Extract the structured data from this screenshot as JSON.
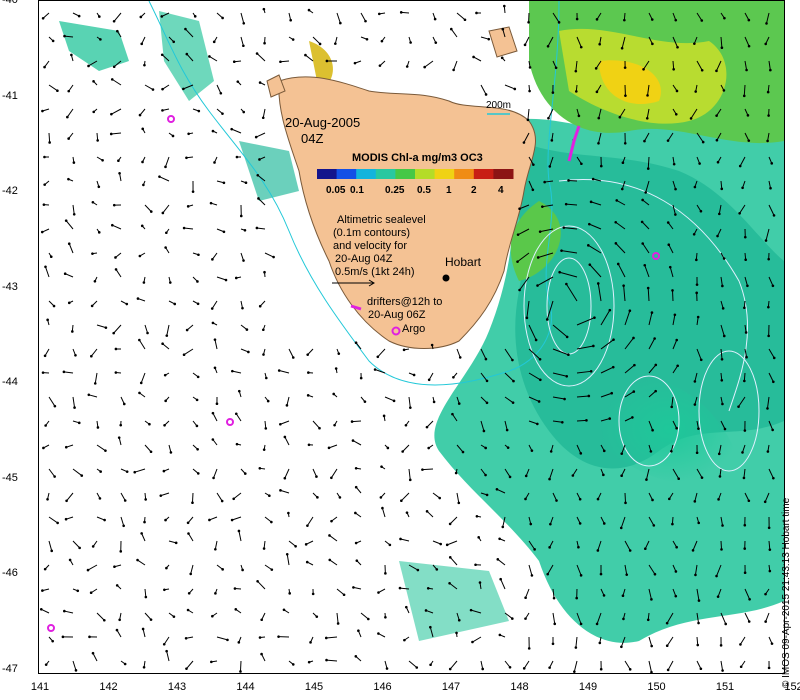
{
  "map": {
    "date_label": "20-Aug-2005",
    "time_label": "04Z",
    "scale_label": "200m",
    "city_label": "Hobart",
    "argo_label": "Argo",
    "colorbar_title": "MODIS Chl-a mg/m3 OC3",
    "colorbar_ticks": [
      "0.05",
      "0.1",
      "0.25",
      "0.5",
      "1",
      "2",
      "4"
    ],
    "legend_text": {
      "line1": "Altimetric sealevel",
      "line2": "(0.1m contours)",
      "line3": "and velocity for",
      "line4": "20-Aug 04Z",
      "line5": "0.5m/s (1kt 24h)"
    },
    "drifters_text": {
      "line1": "drifters@12h to",
      "line2": "20-Aug 06Z"
    },
    "lat_ticks": [
      "-40",
      "-41",
      "-42",
      "-43",
      "-44",
      "-45",
      "-46",
      "-47"
    ],
    "lon_ticks": [
      "141",
      "142",
      "143",
      "144",
      "145",
      "146",
      "147",
      "148",
      "149",
      "150",
      "151",
      "152"
    ],
    "copyright": "© IMOS 09-Apr-2015 21:43:13 Hobart time",
    "colors": {
      "land": "#f4c294",
      "contour": "#e0f0ff",
      "isobath": "#22c8d8",
      "marker": "#e020e0",
      "colorbar": [
        "#14148c",
        "#1450e6",
        "#14b4dc",
        "#28c8a0",
        "#46c846",
        "#b4dc28",
        "#f0d214",
        "#f08c14",
        "#c81e14",
        "#8c1414"
      ]
    }
  }
}
